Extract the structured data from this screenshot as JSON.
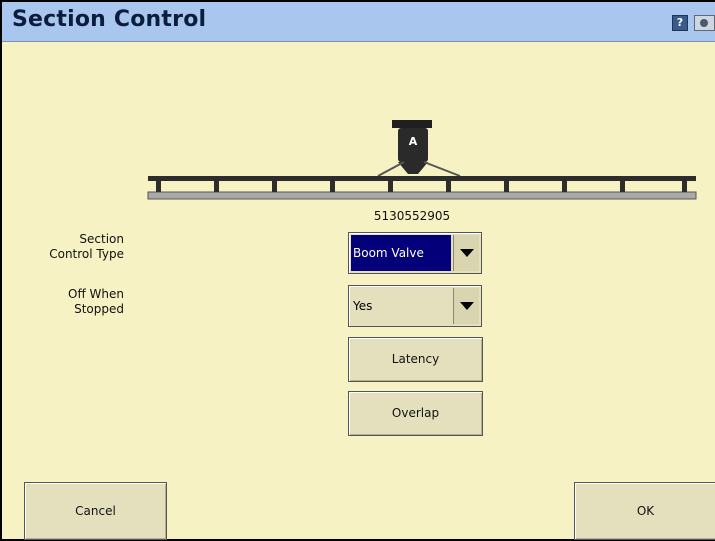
{
  "window": {
    "title": "Section Control",
    "title_icons": [
      "help-icon",
      "camera-icon"
    ],
    "colors": {
      "titlebar": "#a8c6ee",
      "background": "#f7f2c4",
      "selected": "#04007a"
    }
  },
  "implement": {
    "tank_label": "A",
    "serial": "5130552905",
    "boom_sections": 10
  },
  "fields": {
    "section_control_type": {
      "label": "Section\nControl Type",
      "value": "Boom Valve"
    },
    "off_when_stopped": {
      "label": "Off When\nStopped",
      "value": "Yes"
    }
  },
  "buttons": {
    "latency": "Latency",
    "overlap": "Overlap",
    "cancel": "Cancel",
    "ok": "OK"
  }
}
